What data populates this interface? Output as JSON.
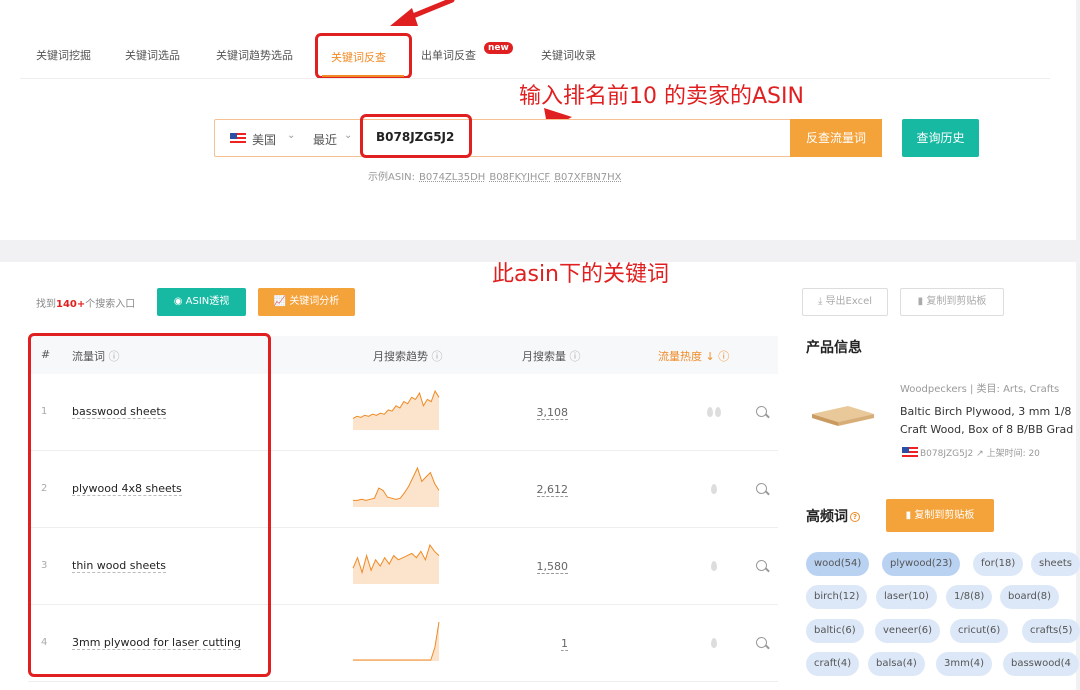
{
  "tabs": [
    {
      "label": "关键词挖掘"
    },
    {
      "label": "关键词选品"
    },
    {
      "label": "关键词趋势选品"
    },
    {
      "label": "关键词反查",
      "active": true
    },
    {
      "label": "出单词反查"
    },
    {
      "label": "关键词收录"
    }
  ],
  "new_badge": "new",
  "annotations": {
    "search_hint": "输入排名前10 的卖家的ASIN",
    "keywords_hint": "此asin下的关键词"
  },
  "search": {
    "country": "美国",
    "period": "最近",
    "asin_value": "B078JZG5J2",
    "search_button": "反查流量词",
    "history_button": "查询历史",
    "examples_label": "示例ASIN:",
    "examples": [
      "B074ZL35DH",
      "B08FKYJHCF",
      "B07XFBN7HX"
    ]
  },
  "results": {
    "found_prefix": "找到",
    "found_count": "140+",
    "found_suffix": "个搜索入口",
    "asin_btn": "ASIN透视",
    "kw_btn": "关键词分析",
    "export_btn": "导出Excel",
    "copy_btn": "复制到剪贴板"
  },
  "table": {
    "headers": {
      "idx": "#",
      "keyword": "流量词",
      "trend": "月搜索趋势",
      "volume": "月搜索量",
      "hot": "流量热度"
    },
    "rows": [
      {
        "idx": "1",
        "keyword": "basswood sheets",
        "volume": "3,108",
        "trend": [
          10,
          12,
          11,
          13,
          12,
          14,
          13,
          15,
          14,
          18,
          17,
          22,
          20,
          26,
          24,
          30,
          28,
          34,
          22,
          28,
          26,
          36,
          30
        ]
      },
      {
        "idx": "2",
        "keyword": "plywood 4x8 sheets",
        "volume": "2,612",
        "trend": [
          5,
          5,
          6,
          5,
          6,
          7,
          16,
          14,
          8,
          7,
          6,
          7,
          12,
          18,
          26,
          34,
          22,
          26,
          30,
          20,
          14
        ]
      },
      {
        "idx": "3",
        "keyword": "thin wood sheets",
        "volume": "1,580",
        "trend": [
          14,
          24,
          10,
          26,
          12,
          22,
          16,
          24,
          18,
          26,
          22,
          24,
          26,
          28,
          24,
          30,
          22,
          36,
          30,
          26
        ]
      },
      {
        "idx": "4",
        "keyword": "3mm plywood for laser cutting",
        "volume": "1",
        "trend": [
          0,
          0,
          0,
          0,
          0,
          0,
          0,
          0,
          0,
          0,
          0,
          0,
          0,
          0,
          0,
          0,
          0,
          0,
          0,
          0,
          12,
          36
        ]
      }
    ]
  },
  "product": {
    "title": "产品信息",
    "meta": "Woodpeckers | 类目: Arts, Crafts",
    "name_line1": "Baltic Birch Plywood, 3 mm 1/8",
    "name_line2": "Craft Wood, Box of 8 B/BB Grad",
    "asin": "B078JZG5J2",
    "listed": "上架时间: 20"
  },
  "freq": {
    "title": "高频词",
    "copy_btn": "复制到剪贴板",
    "rows": [
      [
        "wood(54)",
        "plywood(23)",
        "for(18)",
        "sheets"
      ],
      [
        "birch(12)",
        "laser(10)",
        "1/8(8)",
        "board(8)"
      ],
      [
        "baltic(6)",
        "veneer(6)",
        "cricut(6)",
        "crafts(5)"
      ],
      [
        "craft(4)",
        "balsa(4)",
        "3mm(4)",
        "basswood(4"
      ]
    ]
  },
  "colors": {
    "accent": "#f08a24",
    "teal": "#18b9a2",
    "annotation": "#e02020"
  }
}
